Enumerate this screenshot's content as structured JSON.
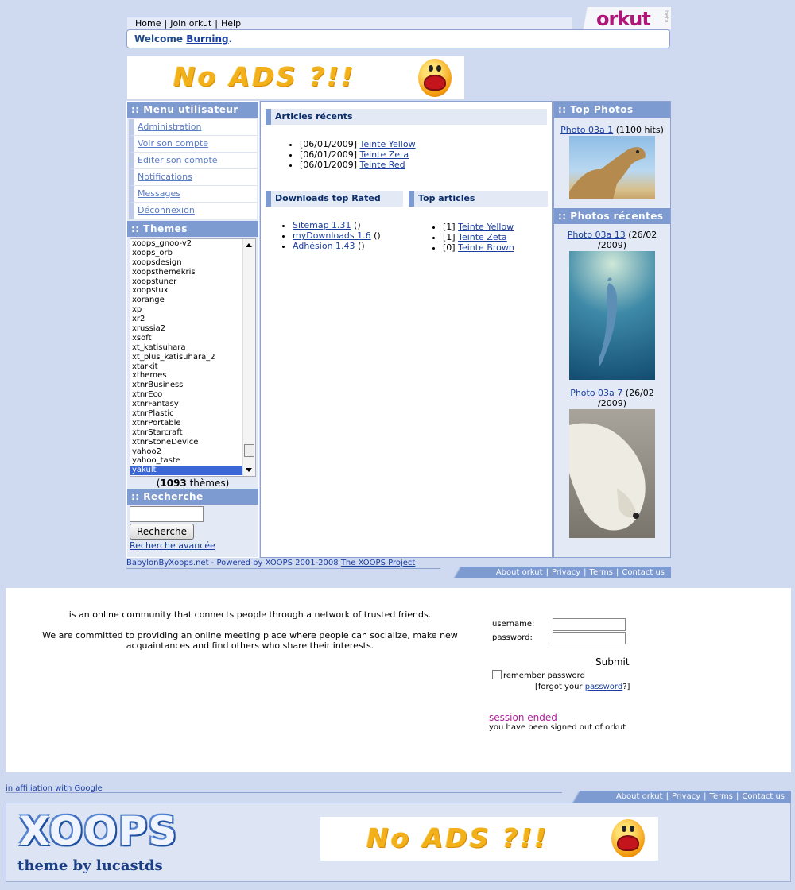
{
  "topnav": {
    "home": "Home",
    "join": "Join orkut",
    "help": "Help",
    "separator": "|"
  },
  "logo": {
    "text": "orkut",
    "beta": "beta"
  },
  "welcome": {
    "prefix": "Welcome",
    "user": "Burning",
    "suffix": "."
  },
  "ads_banner": {
    "text": "No ADS ?!!"
  },
  "user_menu": {
    "title": ":: Menu utilisateur",
    "items": [
      "Administration",
      "Voir son compte",
      "Editer son compte",
      "Notifications",
      "Messages",
      "Déconnexion"
    ]
  },
  "themes": {
    "title": ":: Themes",
    "options": [
      "xoops_gnoo-v2",
      "xoops_orb",
      "xoopsdesign",
      "xoopsthemekris",
      "xoopstuner",
      "xoopstux",
      "xorange",
      "xp",
      "xr2",
      "xrussia2",
      "xsoft",
      "xt_katisuhara",
      "xt_plus_katisuhara_2",
      "xtarkit",
      "xthemes",
      "xtnrBusiness",
      "xtnrEco",
      "xtnrFantasy",
      "xtnrPlastic",
      "xtnrPortable",
      "xtnrStarcraft",
      "xtnrStoneDevice",
      "yahoo2",
      "yahoo_taste",
      "yakult"
    ],
    "selected": "yakult",
    "count_open": "(",
    "count": "1093",
    "count_suffix": " thèmes)"
  },
  "search": {
    "title": ":: Recherche",
    "button": "Recherche",
    "advanced": "Recherche avancée"
  },
  "recent_articles": {
    "title": "Articles récents",
    "items": [
      {
        "date": "[06/01/2009]",
        "title": "Teinte Yellow"
      },
      {
        "date": "[06/01/2009]",
        "title": "Teinte Zeta"
      },
      {
        "date": "[06/01/2009]",
        "title": "Teinte Red"
      }
    ]
  },
  "downloads_top": {
    "title": "Downloads top Rated",
    "items": [
      {
        "title": "Sitemap 1.31",
        "extra": " ()"
      },
      {
        "title": "myDownloads 1.6",
        "extra": " ()"
      },
      {
        "title": "Adhésion 1.43",
        "extra": " ()"
      }
    ]
  },
  "top_articles": {
    "title": "Top articles",
    "items": [
      {
        "count": "[1]",
        "title": "Teinte Yellow"
      },
      {
        "count": "[1]",
        "title": "Teinte Zeta"
      },
      {
        "count": "[0]",
        "title": "Teinte Brown"
      }
    ]
  },
  "top_photos": {
    "title": ":: Top Photos",
    "items": [
      {
        "title": "Photo 03a 1",
        "meta": " (1100 hits)"
      }
    ]
  },
  "recent_photos": {
    "title": ":: Photos récentes",
    "items": [
      {
        "title": "Photo 03a 13",
        "meta": " (26/02",
        "meta2": "/2009)"
      },
      {
        "title": "Photo 03a 7",
        "meta": " (26/02",
        "meta2": "/2009)"
      }
    ]
  },
  "footer1": {
    "left_text": "BabylonByXoops.net - Powered by XOOPS 2001-2008 ",
    "left_link": "The XOOPS Project",
    "links": [
      "About orkut",
      "Privacy",
      "Terms",
      "Contact us"
    ],
    "separator": "|"
  },
  "login": {
    "desc1": "is an online community that connects people through a network of trusted friends.",
    "desc2": "We are committed to providing an online meeting place where people can socialize, make new acquaintances and find others who share their interests.",
    "username_label": "username:",
    "password_label": "password:",
    "submit": "Submit",
    "remember": "remember password",
    "forgot_prefix": "[forgot your ",
    "forgot_link": "password",
    "forgot_suffix": "?]",
    "session_title": "session ended",
    "session_text": "you have been signed out of orkut"
  },
  "footer2": {
    "left_text": "in affiliation with Google",
    "links": [
      "About orkut",
      "Privacy",
      "Terms",
      "Contact us"
    ],
    "separator": "|"
  },
  "bottom": {
    "logo_word": "XOOPS",
    "logo_sub": "theme by lucastds",
    "ads_text": "No ADS ?!!"
  },
  "colors": {
    "accent": "#7d9bd0",
    "link": "#1a3fa0",
    "background": "#cfd9ef",
    "orkut": "#b0157a",
    "session": "#b21f9d"
  }
}
